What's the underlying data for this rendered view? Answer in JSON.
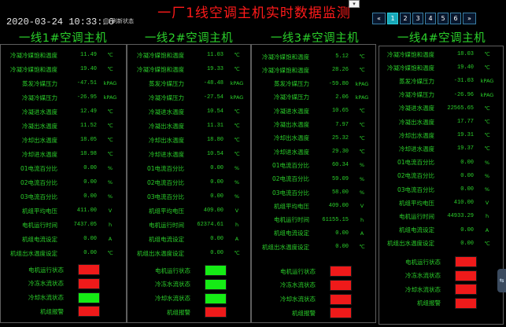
{
  "header": {
    "datetime": "2020-03-24 10:33:16",
    "refresh_label": "刷新状态",
    "title": "一厂1线空调主机实时数据监测",
    "select_arrow": "▾"
  },
  "pager": {
    "first": "«",
    "pages": [
      "1",
      "2",
      "3",
      "4",
      "5",
      "6"
    ],
    "active": "1",
    "last": "»"
  },
  "panels": [
    {
      "title": "一线1#空调主机",
      "metrics": [
        {
          "label": "冷凝冷媒饱和温度",
          "value": "11.49",
          "unit": "℃"
        },
        {
          "label": "冷凝冷媒饱和温度",
          "value": "19.40",
          "unit": "℃"
        },
        {
          "label": "蒸发冷媒压力",
          "value": "-47.51",
          "unit": "kPAG"
        },
        {
          "label": "冷凝冷媒压力",
          "value": "-26.95",
          "unit": "kPAG"
        },
        {
          "label": "冷凝进水温度",
          "value": "12.49",
          "unit": "℃"
        },
        {
          "label": "冷凝出水温度",
          "value": "11.52",
          "unit": "℃"
        },
        {
          "label": "冷却出水温度",
          "value": "18.05",
          "unit": "℃"
        },
        {
          "label": "冷却进水温度",
          "value": "18.98",
          "unit": "℃"
        },
        {
          "label": "01电流百分比",
          "value": "0.00",
          "unit": "%"
        },
        {
          "label": "02电流百分比",
          "value": "0.00",
          "unit": "%"
        },
        {
          "label": "03电流百分比",
          "value": "0.00",
          "unit": "%"
        },
        {
          "label": "机组平均电压",
          "value": "411.00",
          "unit": "V"
        },
        {
          "label": "电机运行时间",
          "value": "7437.05",
          "unit": "h"
        },
        {
          "label": "机组电流设定",
          "value": "0.00",
          "unit": "A"
        },
        {
          "label": "机组出水温度设定",
          "value": "0.00",
          "unit": "℃"
        }
      ],
      "statuses": [
        {
          "label": "电机运行状态",
          "color": "#ef1a1a"
        },
        {
          "label": "冷冻水流状态",
          "color": "#ef1a1a"
        },
        {
          "label": "冷却水流状态",
          "color": "#15ec15"
        },
        {
          "label": "机组报警",
          "color": "#ef1a1a"
        }
      ]
    },
    {
      "title": "一线2#空调主机",
      "metrics": [
        {
          "label": "冷凝冷媒饱和温度",
          "value": "11.03",
          "unit": "℃"
        },
        {
          "label": "冷凝冷媒饱和温度",
          "value": "19.33",
          "unit": "℃"
        },
        {
          "label": "蒸发冷媒压力",
          "value": "-48.48",
          "unit": "kPAG"
        },
        {
          "label": "冷凝冷媒压力",
          "value": "-27.54",
          "unit": "kPAG"
        },
        {
          "label": "冷凝进水温度",
          "value": "10.54",
          "unit": "℃"
        },
        {
          "label": "冷凝出水温度",
          "value": "11.31",
          "unit": "℃"
        },
        {
          "label": "冷却出水温度",
          "value": "18.80",
          "unit": "℃"
        },
        {
          "label": "冷却进水温度",
          "value": "10.54",
          "unit": "℃"
        },
        {
          "label": "01电流百分比",
          "value": "0.00",
          "unit": "%"
        },
        {
          "label": "02电流百分比",
          "value": "0.00",
          "unit": "%"
        },
        {
          "label": "03电流百分比",
          "value": "0.00",
          "unit": "%"
        },
        {
          "label": "机组平均电压",
          "value": "409.00",
          "unit": "V"
        },
        {
          "label": "电机运行时间",
          "value": "62374.61",
          "unit": "h"
        },
        {
          "label": "机组电流设定",
          "value": "0.00",
          "unit": "A"
        },
        {
          "label": "机组出水温度设定",
          "value": "0.00",
          "unit": "℃"
        }
      ],
      "statuses": [
        {
          "label": "电机运行状态",
          "color": "#15ec15"
        },
        {
          "label": "冷冻水流状态",
          "color": "#15ec15"
        },
        {
          "label": "冷却水流状态",
          "color": "#15ec15"
        },
        {
          "label": "机组报警",
          "color": "#ef1a1a"
        }
      ]
    },
    {
      "title": "一线3#空调主机",
      "metrics": [
        {
          "label": "冷凝冷媒饱和温度",
          "value": "5.12",
          "unit": "℃"
        },
        {
          "label": "冷凝冷媒饱和温度",
          "value": "28.26",
          "unit": "℃"
        },
        {
          "label": "蒸发冷媒压力",
          "value": "-59.80",
          "unit": "kPAG"
        },
        {
          "label": "冷凝冷媒压力",
          "value": "2.06",
          "unit": "kPAG"
        },
        {
          "label": "冷凝进水温度",
          "value": "10.65",
          "unit": "℃"
        },
        {
          "label": "冷凝出水温度",
          "value": "7.97",
          "unit": "℃"
        },
        {
          "label": "冷却出水温度",
          "value": "25.32",
          "unit": "℃"
        },
        {
          "label": "冷却进水温度",
          "value": "29.30",
          "unit": "℃"
        },
        {
          "label": "01电流百分比",
          "value": "60.34",
          "unit": "%"
        },
        {
          "label": "02电流百分比",
          "value": "59.09",
          "unit": "%"
        },
        {
          "label": "03电流百分比",
          "value": "58.00",
          "unit": "%"
        },
        {
          "label": "机组平均电压",
          "value": "409.00",
          "unit": "V"
        },
        {
          "label": "电机运行时间",
          "value": "61155.15",
          "unit": "h"
        },
        {
          "label": "机组电流设定",
          "value": "0.00",
          "unit": "A"
        },
        {
          "label": "机组出水温度设定",
          "value": "0.00",
          "unit": "℃"
        }
      ],
      "statuses": [
        {
          "label": "电机运行状态",
          "color": "#ef1a1a"
        },
        {
          "label": "冷冻水流状态",
          "color": "#ef1a1a"
        },
        {
          "label": "冷却水流状态",
          "color": "#ef1a1a"
        },
        {
          "label": "机组报警",
          "color": "#ef1a1a"
        }
      ]
    },
    {
      "title": "一线4#空调主机",
      "metrics": [
        {
          "label": "冷凝冷媒饱和温度",
          "value": "18.03",
          "unit": "℃"
        },
        {
          "label": "冷凝冷媒饱和温度",
          "value": "19.40",
          "unit": "℃"
        },
        {
          "label": "蒸发冷媒压力",
          "value": "-31.03",
          "unit": "kPAG"
        },
        {
          "label": "冷凝冷媒压力",
          "value": "-26.96",
          "unit": "kPAG"
        },
        {
          "label": "冷凝进水温度",
          "value": "22565.65",
          "unit": "℃"
        },
        {
          "label": "冷凝出水温度",
          "value": "17.77",
          "unit": "℃"
        },
        {
          "label": "冷却出水温度",
          "value": "19.31",
          "unit": "℃"
        },
        {
          "label": "冷却进水温度",
          "value": "19.37",
          "unit": "℃"
        },
        {
          "label": "01电流百分比",
          "value": "0.00",
          "unit": "%"
        },
        {
          "label": "02电流百分比",
          "value": "0.00",
          "unit": "%"
        },
        {
          "label": "03电流百分比",
          "value": "0.00",
          "unit": "%"
        },
        {
          "label": "机组平均电压",
          "value": "410.00",
          "unit": "V"
        },
        {
          "label": "电机运行时间",
          "value": "44933.29",
          "unit": "h"
        },
        {
          "label": "机组电流设定",
          "value": "0.00",
          "unit": "A"
        },
        {
          "label": "机组出水温度设定",
          "value": "0.00",
          "unit": "℃"
        }
      ],
      "statuses": [
        {
          "label": "电机运行状态",
          "color": "#ef1a1a"
        },
        {
          "label": "冷冻水流状态",
          "color": "#ef1a1a"
        },
        {
          "label": "冷却水流状态",
          "color": "#ef1a1a"
        },
        {
          "label": "机组报警",
          "color": "#ef1a1a"
        }
      ]
    }
  ],
  "side_tab": {
    "glyph": "⇆"
  }
}
